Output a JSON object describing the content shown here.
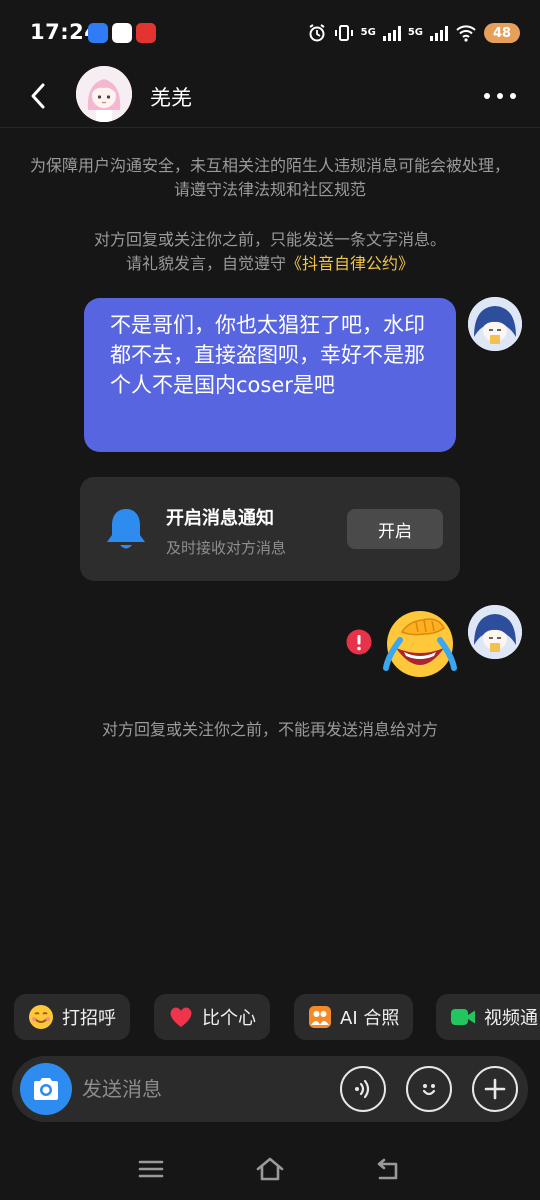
{
  "status_bar": {
    "time": "17:24",
    "network_1": "5G",
    "network_2": "5G",
    "battery": "48"
  },
  "header": {
    "contact_name": "羌羌"
  },
  "notices": {
    "safety": "为保障用户沟通安全，未互相关注的陌生人违规消息可能会被处理，请遵守法律法规和社区规范",
    "policy_line1": "对方回复或关注你之前，只能发送一条文字消息。",
    "policy_line2_prefix": "请礼貌发言，自觉遵守",
    "policy_link": "《抖音自律公约》",
    "blocked": "对方回复或关注你之前，不能再发送消息给对方"
  },
  "messages": [
    {
      "from": "self",
      "type": "text",
      "text": "不是哥们，你也太猖狂了吧，水印都不去，直接盗图呗，幸好不是那个人不是国内coser是吧"
    },
    {
      "from": "self",
      "type": "emoji",
      "emoji": "laugh-cry-emoji",
      "status": "failed"
    }
  ],
  "notification_card": {
    "title": "开启消息通知",
    "subtitle": "及时接收对方消息",
    "button": "开启"
  },
  "quick_replies": [
    {
      "label": "打招呼",
      "icon": "smile-emoji-icon"
    },
    {
      "label": "比个心",
      "icon": "heart-icon"
    },
    {
      "label": "AI 合照",
      "icon": "ai-photo-icon"
    },
    {
      "label": "视频通",
      "icon": "video-call-icon"
    }
  ],
  "input": {
    "placeholder": "发送消息"
  },
  "colors": {
    "background": "#161616",
    "bubble": "#5865e0",
    "card": "#2d2d2d",
    "link": "#f1c54a",
    "accent": "#2e8bf0",
    "error": "#e8324a"
  }
}
